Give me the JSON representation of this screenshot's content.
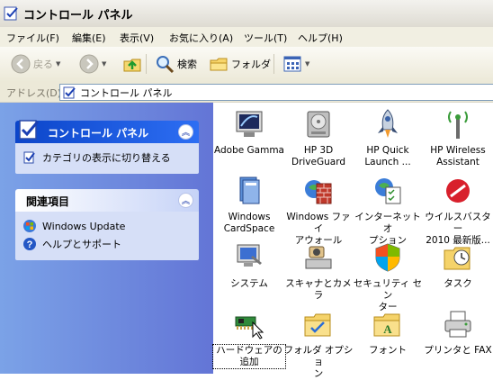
{
  "window": {
    "title": "コントロール パネル"
  },
  "menu": [
    {
      "label": "ファイル(F)"
    },
    {
      "label": "編集(E)"
    },
    {
      "label": "表示(V)"
    },
    {
      "label": "お気に入り(A)"
    },
    {
      "label": "ツール(T)"
    },
    {
      "label": "ヘルプ(H)"
    }
  ],
  "toolbar": {
    "back": "戻る",
    "search": "検索",
    "folders": "フォルダ"
  },
  "address": {
    "label": "アドレス(D)",
    "value": "コントロール パネル"
  },
  "sidebar": {
    "control_panel": {
      "title": "コントロール パネル",
      "task": "カテゴリの表示に切り替える"
    },
    "related": {
      "title": "関連項目",
      "items": [
        {
          "label": "Windows Update",
          "icon": "windows-update-icon"
        },
        {
          "label": "ヘルプとサポート",
          "icon": "help-icon"
        }
      ]
    }
  },
  "items": [
    {
      "label": "Adobe Gamma",
      "icon": "adobe-gamma-icon"
    },
    {
      "label": "HP 3D\nDriveGuard",
      "icon": "drive-guard-icon"
    },
    {
      "label": "HP Quick\nLaunch ...",
      "icon": "rocket-icon"
    },
    {
      "label": "HP Wireless\nAssistant",
      "icon": "wireless-icon"
    },
    {
      "label": "Windows\nCardSpace",
      "icon": "cardspace-icon"
    },
    {
      "label": "Windows ファイ\nアウォール",
      "icon": "firewall-icon"
    },
    {
      "label": "インターネット オ\nプション",
      "icon": "internet-options-icon"
    },
    {
      "label": "ウイルスバスター\n2010 最新版...",
      "icon": "virusbuster-icon"
    },
    {
      "label": "システム",
      "icon": "system-icon"
    },
    {
      "label": "スキャナとカメラ",
      "icon": "scanner-camera-icon"
    },
    {
      "label": "セキュリティ セン\nター",
      "icon": "security-center-icon"
    },
    {
      "label": "タスク",
      "icon": "task-scheduler-icon"
    },
    {
      "label": "ハードウェアの\n追加",
      "icon": "add-hardware-icon"
    },
    {
      "label": "フォルダ オプショ\nン",
      "icon": "folder-options-icon"
    },
    {
      "label": "フォント",
      "icon": "fonts-icon"
    },
    {
      "label": "プリンタと FAX",
      "icon": "printer-fax-icon"
    }
  ]
}
